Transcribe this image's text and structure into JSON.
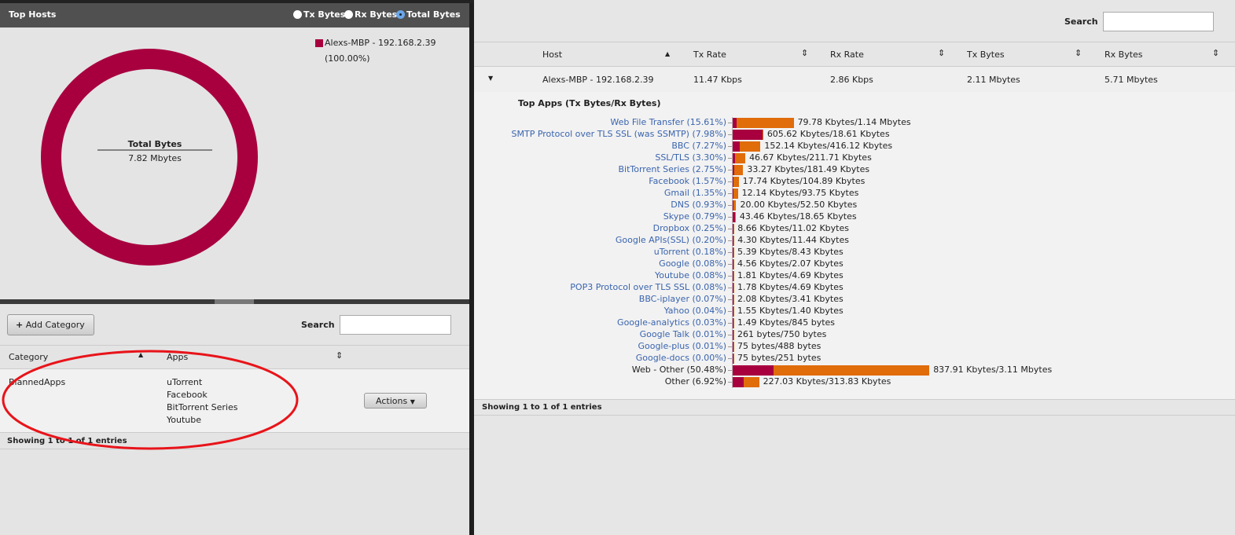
{
  "top_hosts": {
    "title": "Top Hosts",
    "radios": [
      {
        "label": "Tx Bytes",
        "selected": false
      },
      {
        "label": "Rx Bytes",
        "selected": false
      },
      {
        "label": "Total Bytes",
        "selected": true
      }
    ],
    "legend": {
      "label": "Alexs-MBP - 192.168.2.39",
      "percent": "(100.00%)",
      "color": "#a8003f"
    },
    "center_title": "Total Bytes",
    "center_value": "7.82 Mbytes"
  },
  "categories": {
    "add_button": "Add Category",
    "search_label": "Search",
    "search_value": "",
    "columns": [
      "Category",
      "Apps"
    ],
    "rows": [
      {
        "category": "BlannedApps",
        "apps": [
          "uTorrent",
          "Facebook",
          "BitTorrent Series",
          "Youtube"
        ],
        "actions": "Actions"
      }
    ],
    "footer": "Showing 1 to 1 of 1 entries",
    "annotation_color": "#e8141a"
  },
  "hosts": {
    "search_label": "Search",
    "search_value": "",
    "columns": [
      "Host",
      "Tx Rate",
      "Rx Rate",
      "Tx Bytes",
      "Rx Bytes"
    ],
    "rows": [
      {
        "host": "Alexs-MBP - 192.168.2.39",
        "tx_rate": "11.47 Kbps",
        "rx_rate": "2.86 Kbps",
        "tx_bytes": "2.11 Mbytes",
        "rx_bytes": "5.71 Mbytes"
      }
    ],
    "footer": "Showing 1 to 1 of 1 entries"
  },
  "chart_data": {
    "type": "bar",
    "title": "Top Apps (Tx Bytes/Rx Bytes)",
    "stacked": true,
    "orientation": "horizontal",
    "colors": {
      "tx": "#a8003f",
      "rx": "#e06c0a"
    },
    "apps": [
      {
        "label": "Web File Transfer (15.61%)",
        "link": true,
        "tx": "79.78 Kbytes",
        "rx": "1.14 Mbytes"
      },
      {
        "label": "SMTP Protocol over TLS SSL (was SSMTP) (7.98%)",
        "link": true,
        "tx": "605.62 Kbytes",
        "rx": "18.61 Kbytes"
      },
      {
        "label": "BBC (7.27%)",
        "link": true,
        "tx": "152.14 Kbytes",
        "rx": "416.12 Kbytes"
      },
      {
        "label": "SSL/TLS (3.30%)",
        "link": true,
        "tx": "46.67 Kbytes",
        "rx": "211.71 Kbytes"
      },
      {
        "label": "BitTorrent Series (2.75%)",
        "link": true,
        "tx": "33.27 Kbytes",
        "rx": "181.49 Kbytes"
      },
      {
        "label": "Facebook (1.57%)",
        "link": true,
        "tx": "17.74 Kbytes",
        "rx": "104.89 Kbytes"
      },
      {
        "label": "Gmail (1.35%)",
        "link": true,
        "tx": "12.14 Kbytes",
        "rx": "93.75 Kbytes"
      },
      {
        "label": "DNS (0.93%)",
        "link": true,
        "tx": "20.00 Kbytes",
        "rx": "52.50 Kbytes"
      },
      {
        "label": "Skype (0.79%)",
        "link": true,
        "tx": "43.46 Kbytes",
        "rx": "18.65 Kbytes"
      },
      {
        "label": "Dropbox (0.25%)",
        "link": true,
        "tx": "8.66 Kbytes",
        "rx": "11.02 Kbytes"
      },
      {
        "label": "Google APIs(SSL) (0.20%)",
        "link": true,
        "tx": "4.30 Kbytes",
        "rx": "11.44 Kbytes"
      },
      {
        "label": "uTorrent (0.18%)",
        "link": true,
        "tx": "5.39 Kbytes",
        "rx": "8.43 Kbytes"
      },
      {
        "label": "Google (0.08%)",
        "link": true,
        "tx": "4.56 Kbytes",
        "rx": "2.07 Kbytes"
      },
      {
        "label": "Youtube (0.08%)",
        "link": true,
        "tx": "1.81 Kbytes",
        "rx": "4.69 Kbytes"
      },
      {
        "label": "POP3 Protocol over TLS SSL (0.08%)",
        "link": true,
        "tx": "1.78 Kbytes",
        "rx": "4.69 Kbytes"
      },
      {
        "label": "BBC-iplayer (0.07%)",
        "link": true,
        "tx": "2.08 Kbytes",
        "rx": "3.41 Kbytes"
      },
      {
        "label": "Yahoo (0.04%)",
        "link": true,
        "tx": "1.55 Kbytes",
        "rx": "1.40 Kbytes"
      },
      {
        "label": "Google-analytics (0.03%)",
        "link": true,
        "tx": "1.49 Kbytes",
        "rx": "845 bytes"
      },
      {
        "label": "Google Talk (0.01%)",
        "link": true,
        "tx": "261 bytes",
        "rx": "750 bytes"
      },
      {
        "label": "Google-plus (0.01%)",
        "link": true,
        "tx": "75 bytes",
        "rx": "488 bytes"
      },
      {
        "label": "Google-docs (0.00%)",
        "link": true,
        "tx": "75 bytes",
        "rx": "251 bytes"
      },
      {
        "label": "Web - Other (50.48%)",
        "link": false,
        "tx": "837.91 Kbytes",
        "rx": "3.11 Mbytes"
      },
      {
        "label": "Other (6.92%)",
        "link": false,
        "tx": "227.03 Kbytes",
        "rx": "313.83 Kbytes"
      }
    ]
  }
}
